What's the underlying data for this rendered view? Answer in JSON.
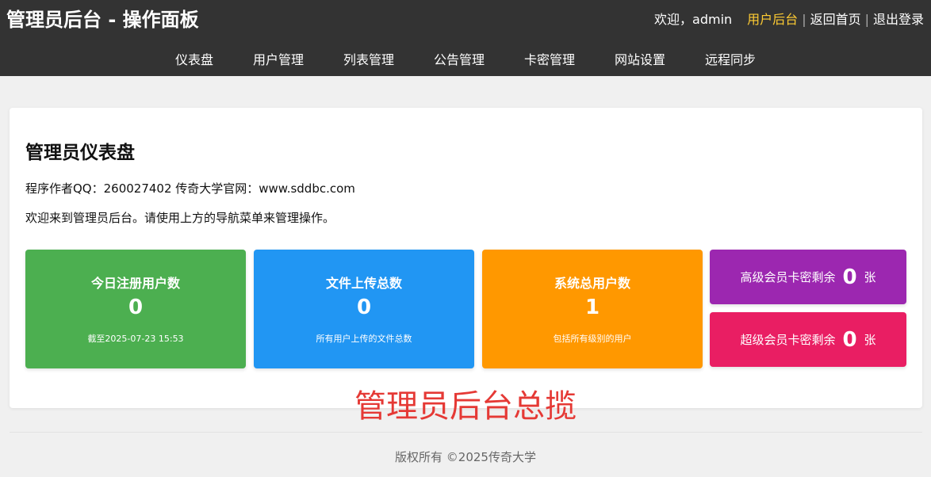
{
  "header": {
    "title": "管理员后台 - 操作面板",
    "welcome": "欢迎，admin",
    "links": {
      "user_backend": "用户后台",
      "home": "返回首页",
      "logout": "退出登录"
    },
    "separator": "|",
    "active_color": "#ffcc33"
  },
  "nav": {
    "items": [
      "仪表盘",
      "用户管理",
      "列表管理",
      "公告管理",
      "卡密管理",
      "网站设置",
      "远程同步"
    ]
  },
  "dashboard": {
    "title": "管理员仪表盘",
    "author_info": "程序作者QQ：260027402 传奇大学官网：www.sddbc.com",
    "welcome_text": "欢迎来到管理员后台。请使用上方的导航菜单来管理操作。",
    "stats": [
      {
        "label": "今日注册用户数",
        "value": "0",
        "desc": "截至2025-07-23 15:53",
        "color": "#4caf50"
      },
      {
        "label": "文件上传总数",
        "value": "0",
        "desc": "所有用户上传的文件总数",
        "color": "#2196f3"
      },
      {
        "label": "系统总用户数",
        "value": "1",
        "desc": "包括所有级别的用户",
        "color": "#ff9800"
      }
    ],
    "cards": [
      {
        "label": "高级会员卡密剩余",
        "value": "0",
        "unit": "张",
        "color": "#9c27b0"
      },
      {
        "label": "超级会员卡密剩余",
        "value": "0",
        "unit": "张",
        "color": "#e91e63"
      }
    ]
  },
  "overlay_caption": "管理员后台总揽",
  "footer": {
    "copyright": "版权所有 ©2025传奇大学"
  }
}
